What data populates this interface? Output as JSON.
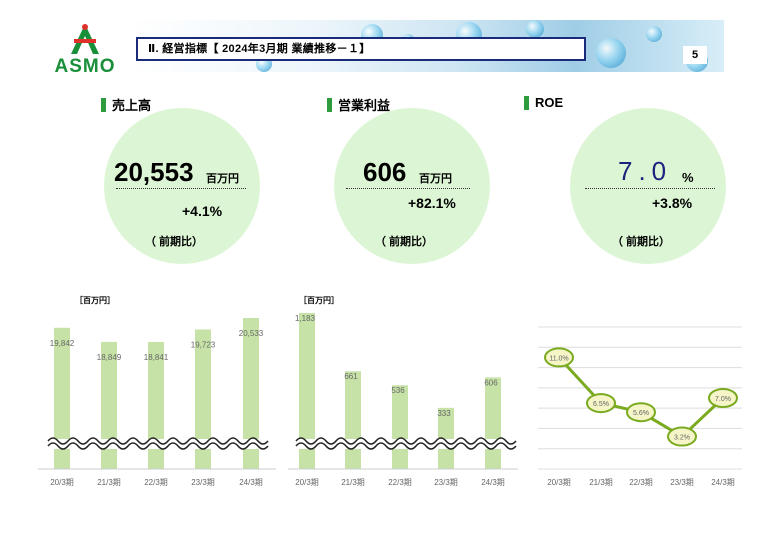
{
  "header": {
    "logo_text": "ASMO",
    "title": "Ⅱ. 経営指標【 2024年3月期  業績推移－１】",
    "page_number": "5"
  },
  "kpis": {
    "sales": {
      "label": "売上高",
      "value": "20,553",
      "unit": "百万円",
      "change": "+4.1%",
      "note": "（  前期比）"
    },
    "operating_profit": {
      "label": "営業利益",
      "value": "606",
      "unit": "百万円",
      "change": "+82.1%",
      "note": "（  前期比）"
    },
    "roe": {
      "label": "ROE",
      "value": "7.0",
      "unit": "%",
      "change": "+3.8%",
      "note": "（  前期比）"
    }
  },
  "colors": {
    "bar": "#c6e2a7",
    "kpi_circle": "#dcf6d5",
    "accent": "#2e9c3c",
    "roe_line": "#7aaa1f",
    "roe_marker": "#f5f5c8",
    "header_border": "#1a2b7a"
  },
  "chart_data": [
    {
      "type": "bar",
      "title": "",
      "unit_label": "［百万円］",
      "categories": [
        "20/3期",
        "21/3期",
        "22/3期",
        "23/3期",
        "24/3期"
      ],
      "values": [
        19842,
        18849,
        18841,
        19723,
        20533
      ],
      "data_labels": [
        "19,842",
        "18,849",
        "18,841",
        "19,723",
        "20,533"
      ],
      "axis_break": true
    },
    {
      "type": "bar",
      "title": "",
      "unit_label": "［百万円］",
      "categories": [
        "20/3期",
        "21/3期",
        "22/3期",
        "23/3期",
        "24/3期"
      ],
      "values": [
        1183,
        661,
        536,
        333,
        606
      ],
      "data_labels": [
        "1,183",
        "661",
        "536",
        "333",
        "606"
      ],
      "axis_break": true
    },
    {
      "type": "line",
      "title": "",
      "categories": [
        "20/3期",
        "21/3期",
        "22/3期",
        "23/3期",
        "24/3期"
      ],
      "values": [
        11.0,
        6.5,
        5.6,
        3.2,
        7.0
      ],
      "data_labels": [
        "11.0%",
        "6.5%",
        "5.6%",
        "3.2%",
        "7.0%"
      ],
      "ylim": [
        0,
        14
      ],
      "grid": true
    }
  ]
}
